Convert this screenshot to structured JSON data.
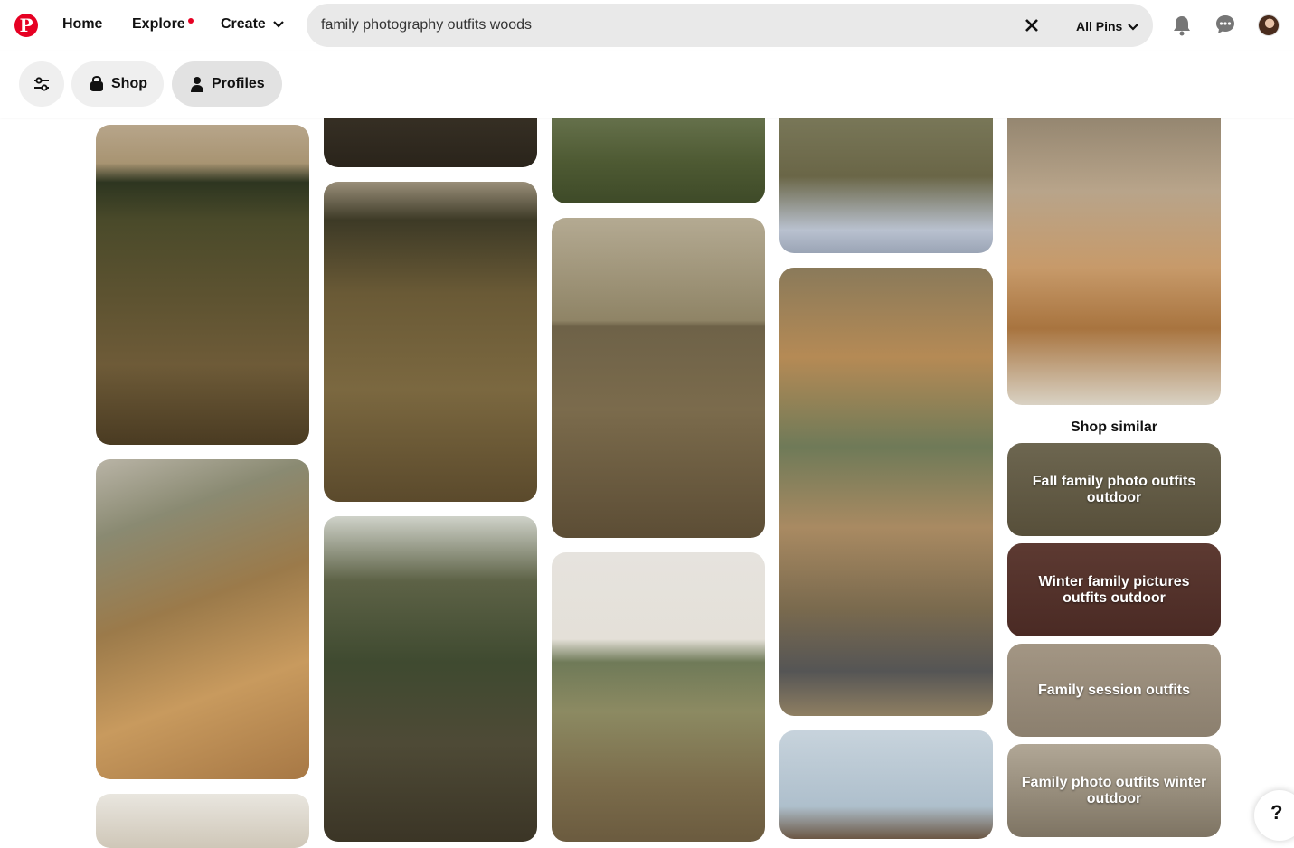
{
  "header": {
    "logo_letter": "P",
    "nav": {
      "home": "Home",
      "explore": "Explore",
      "create": "Create"
    },
    "search": {
      "query": "family photography outfits woods",
      "filter_label": "All Pins"
    }
  },
  "filters": {
    "shop_label": "Shop",
    "profiles_label": "Profiles"
  },
  "shop_similar": {
    "title": "Shop similar",
    "cards": [
      "Fall family photo outfits outdoor",
      "Winter family pictures outfits outdoor",
      "Family session outfits",
      "Family photo outfits winter outdoor"
    ]
  },
  "help_label": "?",
  "colors": {
    "brand": "#e60023"
  }
}
